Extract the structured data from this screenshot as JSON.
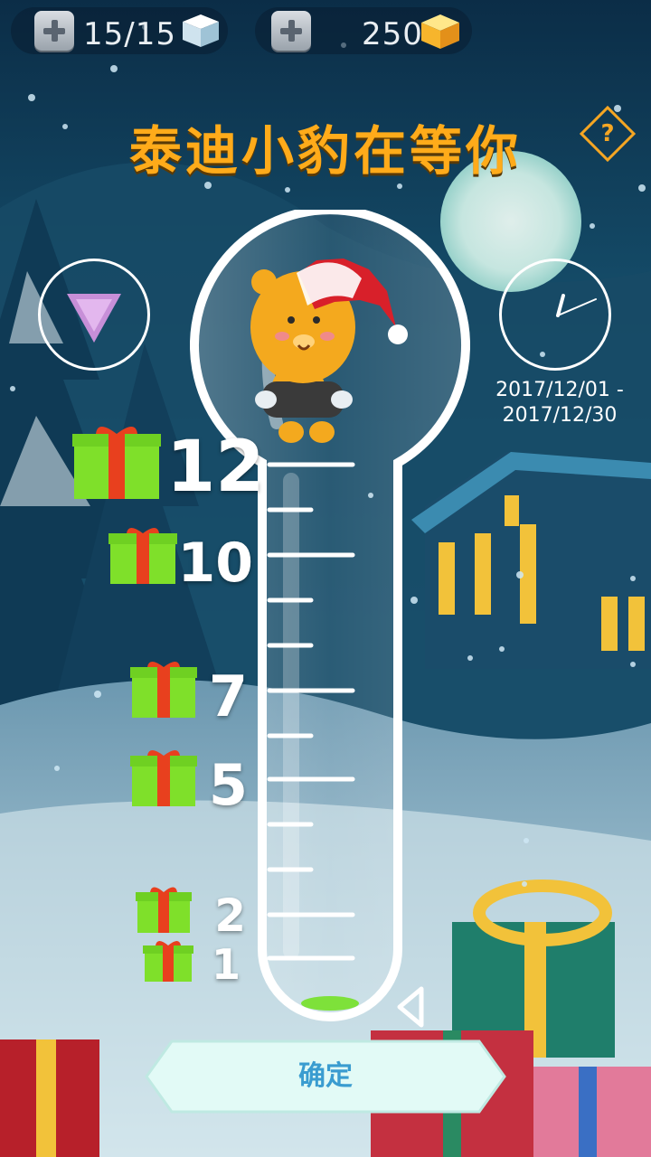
{
  "resources": {
    "energy": {
      "value": "15/15",
      "icon": "ice-cube-icon"
    },
    "coins": {
      "value": "250",
      "icon": "gold-cube-icon"
    }
  },
  "title": "泰迪小豹在等你",
  "event_dates": {
    "line1": "2017/12/01 -",
    "line2": "2017/12/30"
  },
  "milestones": [
    {
      "label": "12"
    },
    {
      "label": "10"
    },
    {
      "label": "7"
    },
    {
      "label": "5"
    },
    {
      "label": "2"
    },
    {
      "label": "1"
    }
  ],
  "confirm_label": "确定",
  "colors": {
    "title": "#ffab1a",
    "confirm_text": "#3a9cd0",
    "gift_box": "#7fe02a",
    "ribbon": "#e8401e"
  }
}
